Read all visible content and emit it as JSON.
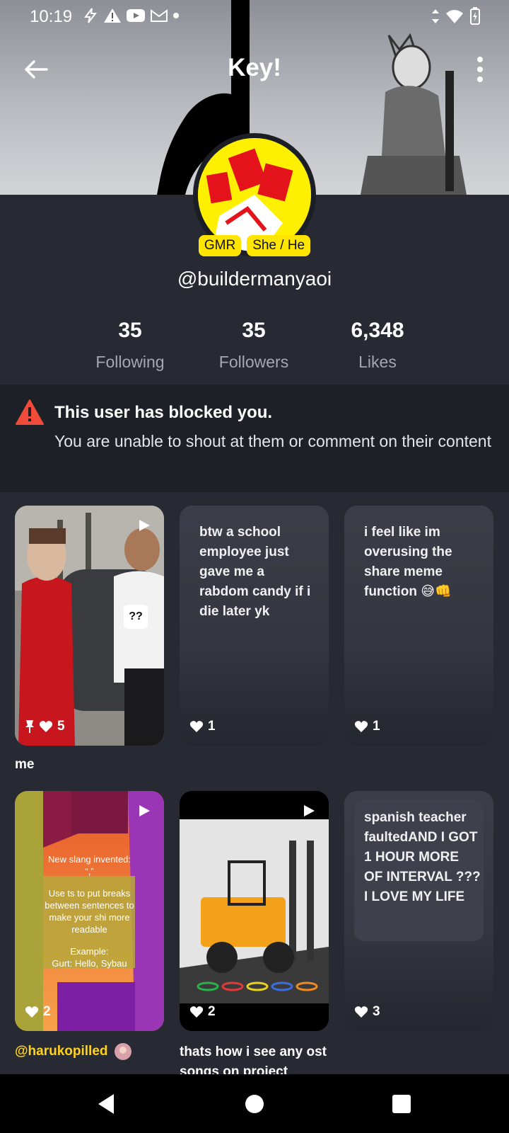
{
  "status_bar": {
    "time": "10:19"
  },
  "header": {
    "title": "Key!"
  },
  "profile": {
    "chips": [
      "GMR",
      "She / He"
    ],
    "handle": "@buildermanyaoi",
    "stats": [
      {
        "value": "35",
        "label": "Following"
      },
      {
        "value": "35",
        "label": "Followers"
      },
      {
        "value": "6,348",
        "label": "Likes"
      }
    ]
  },
  "notice": {
    "heading": "This user has blocked you.",
    "body": "You are unable to shout at them or comment on their content"
  },
  "posts": [
    {
      "type": "video",
      "likes": "5",
      "pinned": true,
      "caption": "me",
      "sticker": "??"
    },
    {
      "type": "text",
      "text": "btw a school employee just gave me a rabdom candy if i die later yk",
      "likes": "1"
    },
    {
      "type": "text",
      "text": "i feel like im overusing the share meme function 😅👊",
      "likes": "1"
    },
    {
      "type": "video",
      "likes": "2",
      "caption": "@harukopilled",
      "overlay": {
        "line1": "New slang invented:",
        "line2": "“,”",
        "line3": "Use ts to put breaks between sentences to make your shi more readable",
        "line4": "Example:",
        "line5": "Gurt: Hello, Sybau"
      }
    },
    {
      "type": "video",
      "likes": "2",
      "caption": "thats how i see any ost songs on project"
    },
    {
      "type": "text",
      "text": "spanish teacher faultedAND I GOT 1 HOUR MORE OF INTERVAL ???I LOVE MY LIFE",
      "likes": "3"
    }
  ],
  "colors": {
    "background": "#272933",
    "notice_bg": "#1e2027",
    "chip": "#ffe500",
    "warning": "#f04b3a",
    "mention": "#ffd21f"
  }
}
